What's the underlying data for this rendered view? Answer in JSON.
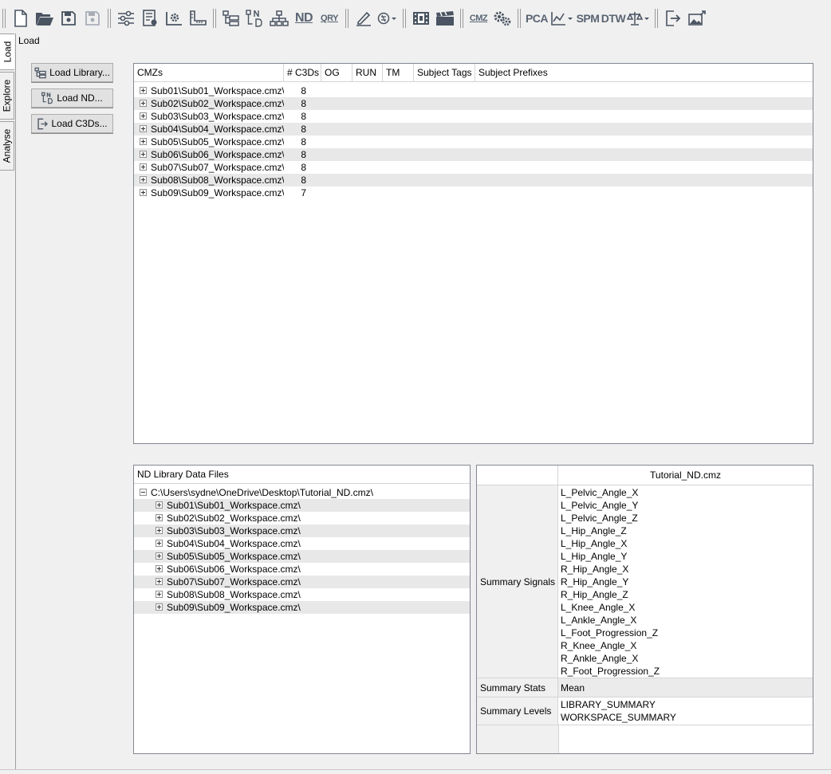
{
  "toolbar": {
    "buttons": [
      "new-icon",
      "open-icon",
      "save-icon",
      "save-as-icon",
      "settings-sliders-icon",
      "properties-icon",
      "workspace-settings-icon",
      "measure-icon",
      "tree-load-icon",
      "load-nd-icon",
      "hierarchy-icon",
      "nd-icon",
      "query-icon",
      "edit-pen-icon",
      "tags-icon",
      "frames-icon",
      "clapperboard-icon",
      "cmz-icon",
      "pipeline-gears-icon",
      "pca-icon",
      "chart-icon",
      "spm-icon",
      "dtw-icon",
      "balance-icon",
      "export-icon",
      "image-export-icon"
    ],
    "nd_label": "ND",
    "qry_label": "QRY",
    "cmz_label": "CMZ",
    "pca_label": "PCA",
    "spm_label": "SPM",
    "dtw_label": "DTW"
  },
  "tabs": [
    {
      "label": "Load"
    },
    {
      "label": "Explore"
    },
    {
      "label": "Analyse"
    }
  ],
  "page_title": "Load",
  "side_buttons": {
    "load_library": "Load Library...",
    "load_nd": "Load ND...",
    "load_c3ds": "Load C3Ds..."
  },
  "cmz_table": {
    "columns": [
      "CMZs",
      "# C3Ds",
      "OG",
      "RUN",
      "TM",
      "Subject Tags",
      "Subject Prefixes"
    ],
    "rows": [
      {
        "name": "Sub01\\Sub01_Workspace.cmz\\",
        "c3ds": "8"
      },
      {
        "name": "Sub02\\Sub02_Workspace.cmz\\",
        "c3ds": "8"
      },
      {
        "name": "Sub03\\Sub03_Workspace.cmz\\",
        "c3ds": "8"
      },
      {
        "name": "Sub04\\Sub04_Workspace.cmz\\",
        "c3ds": "8"
      },
      {
        "name": "Sub05\\Sub05_Workspace.cmz\\",
        "c3ds": "8"
      },
      {
        "name": "Sub06\\Sub06_Workspace.cmz\\",
        "c3ds": "8"
      },
      {
        "name": "Sub07\\Sub07_Workspace.cmz\\",
        "c3ds": "8"
      },
      {
        "name": "Sub08\\Sub08_Workspace.cmz\\",
        "c3ds": "8"
      },
      {
        "name": "Sub09\\Sub09_Workspace.cmz\\",
        "c3ds": "7"
      }
    ]
  },
  "nd_files": {
    "header": "ND Library Data Files",
    "root": "C:\\Users\\sydne\\OneDrive\\Desktop\\Tutorial_ND.cmz\\",
    "children": [
      "Sub01\\Sub01_Workspace.cmz\\",
      "Sub02\\Sub02_Workspace.cmz\\",
      "Sub03\\Sub03_Workspace.cmz\\",
      "Sub04\\Sub04_Workspace.cmz\\",
      "Sub05\\Sub05_Workspace.cmz\\",
      "Sub06\\Sub06_Workspace.cmz\\",
      "Sub07\\Sub07_Workspace.cmz\\",
      "Sub08\\Sub08_Workspace.cmz\\",
      "Sub09\\Sub09_Workspace.cmz\\"
    ]
  },
  "summary": {
    "header": "Tutorial_ND.cmz",
    "signals_label": "Summary Signals",
    "signals": [
      "L_Pelvic_Angle_X",
      "L_Pelvic_Angle_Y",
      "L_Pelvic_Angle_Z",
      "L_Hip_Angle_Z",
      "L_Hip_Angle_X",
      "L_Hip_Angle_Y",
      "R_Hip_Angle_X",
      "R_Hip_Angle_Y",
      "R_Hip_Angle_Z",
      "L_Knee_Angle_X",
      "L_Ankle_Angle_X",
      "L_Foot_Progression_Z",
      "R_Knee_Angle_X",
      "R_Ankle_Angle_X",
      "R_Foot_Progression_Z"
    ],
    "stats_label": "Summary Stats",
    "stats": "Mean",
    "levels_label": "Summary Levels",
    "levels": [
      "LIBRARY_SUMMARY",
      "WORKSPACE_SUMMARY"
    ]
  }
}
